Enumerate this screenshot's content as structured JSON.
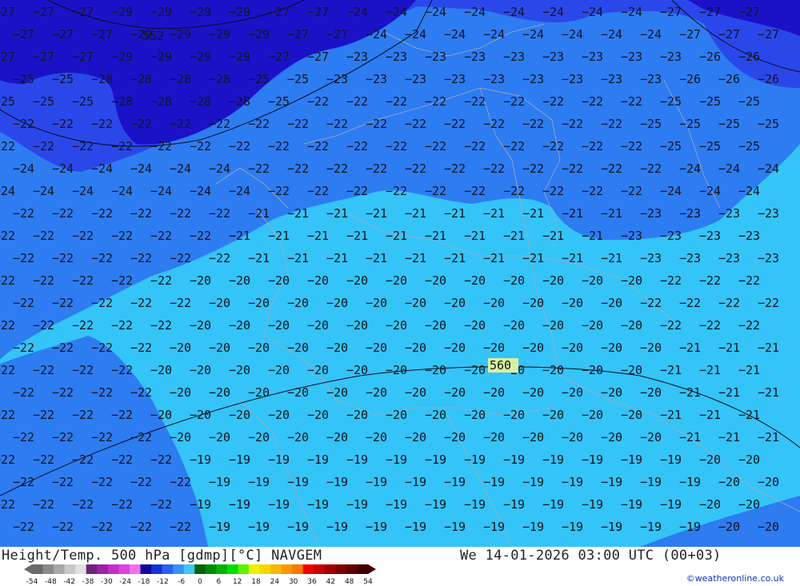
{
  "map": {
    "parameter": "Height/Temp. 500 hPa [gdmp][°C] NAVGEM",
    "valid_time": "We 14-01-2026 03:00 UTC (00+03)",
    "credit": "©weatheronline.co.uk",
    "height_contours": [
      "552",
      "560"
    ],
    "colors": {
      "band_le_minus28": "#1b12c8",
      "band_minus27_minus25": "#2a48ea",
      "band_minus24_minus22": "#2d7cf2",
      "band_minus21_minus19": "#34c4f8",
      "contour_line": "#0a0a1a",
      "borders": "#a8a8b8",
      "label_560_box": "#d8f0a0"
    }
  },
  "legend": {
    "ticks": [
      "-54",
      "-48",
      "-42",
      "-38",
      "-30",
      "-24",
      "-18",
      "-12",
      "-6",
      "0",
      "6",
      "12",
      "18",
      "24",
      "30",
      "36",
      "42",
      "48",
      "54"
    ],
    "colors": [
      "#6a6a6a",
      "#8a8a8a",
      "#a8a8a8",
      "#c8c8c8",
      "#e0e0e0",
      "#70207a",
      "#a020a8",
      "#c030c8",
      "#e040e0",
      "#f070f0",
      "#1008a0",
      "#1830d8",
      "#2860f0",
      "#3890f8",
      "#40c8f8",
      "#006400",
      "#008c00",
      "#00b400",
      "#00dc00",
      "#60f000",
      "#f0f000",
      "#f8d800",
      "#f8b800",
      "#f89800",
      "#f87800",
      "#f00000",
      "#c80000",
      "#a00000",
      "#800000",
      "#600000",
      "#400000"
    ]
  }
}
